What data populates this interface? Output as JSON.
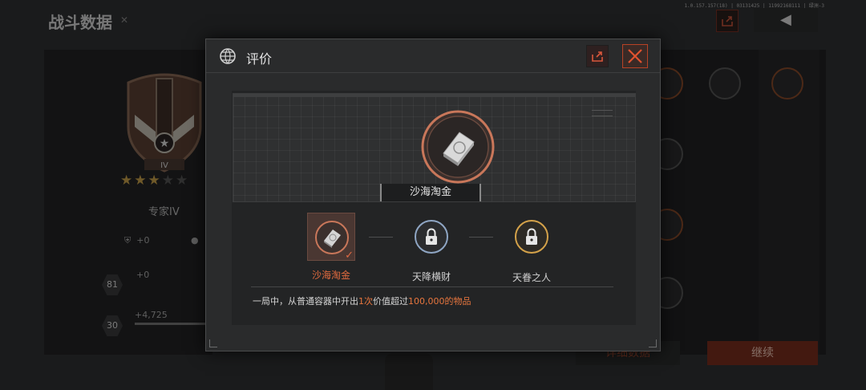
{
  "background": {
    "title": "战斗数据",
    "version_text": "1.0.157.157(18) | 03131425 | 11992168111 | 绿洲-3",
    "rank": {
      "label": "专家IV",
      "emblem_numeral": "IV",
      "stars_filled": 3,
      "stars_total": 5
    },
    "stats": [
      {
        "value": "+0"
      },
      {
        "value": "+0"
      },
      {
        "level": "81",
        "value": "+0"
      },
      {
        "level": "30",
        "value": "+4,725"
      }
    ],
    "buttons": {
      "detail": "详细数据",
      "continue": "继续"
    }
  },
  "modal": {
    "title": "评价",
    "featured": {
      "name": "沙海淘金"
    },
    "achievements": [
      {
        "label": "沙海淘金",
        "selected": true,
        "ring_color": "#c9775a"
      },
      {
        "label": "天降横财",
        "selected": false,
        "ring_color": "#8fa6c4"
      },
      {
        "label": "天眷之人",
        "selected": false,
        "ring_color": "#d4a24a"
      }
    ],
    "description": {
      "prefix": "一局中，从普通容器中开出",
      "count": "1次",
      "middle": "价值超过",
      "value": "100,000的物品"
    }
  },
  "colors": {
    "accent_orange": "#e36b3f",
    "close_border": "#b84225",
    "gold": "#d4a24a"
  }
}
